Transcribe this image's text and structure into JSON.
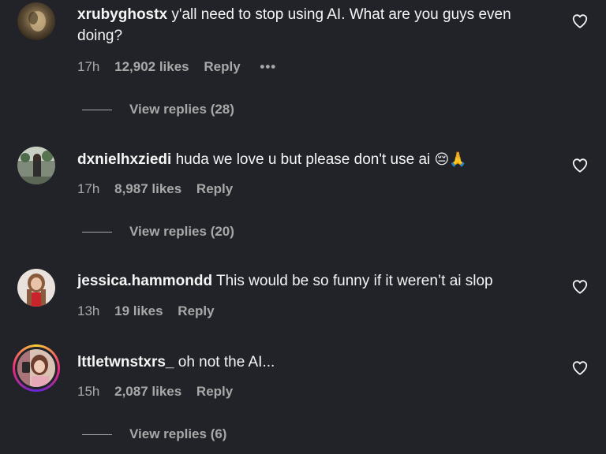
{
  "comments": [
    {
      "username": "xrubyghostx",
      "text": "y'all need to stop using AI. What are you guys even doing?",
      "time": "17h",
      "likes": "12,902 likes",
      "reply": "Reply",
      "more": "•••",
      "view_replies": "View replies (28)"
    },
    {
      "username": "dxnielhxziedi",
      "text": "huda we love u but please don't use ai",
      "emoji": "😔🙏",
      "time": "17h",
      "likes": "8,987 likes",
      "reply": "Reply",
      "view_replies": "View replies (20)"
    },
    {
      "username": "jessica.hammondd",
      "text": "This would be so funny if it weren’t ai slop",
      "time": "13h",
      "likes": "19 likes",
      "reply": "Reply"
    },
    {
      "username": "lttletwnstxrs_",
      "text": "oh not the AI...",
      "time": "15h",
      "likes": "2,087 likes",
      "reply": "Reply",
      "view_replies": "View replies (6)"
    }
  ],
  "icons": {
    "like": "heart-outline-icon",
    "more": "more-options-icon"
  },
  "colors": {
    "background": "#212328",
    "text_primary": "#f5f5f5",
    "text_secondary": "#a8a8a8"
  }
}
